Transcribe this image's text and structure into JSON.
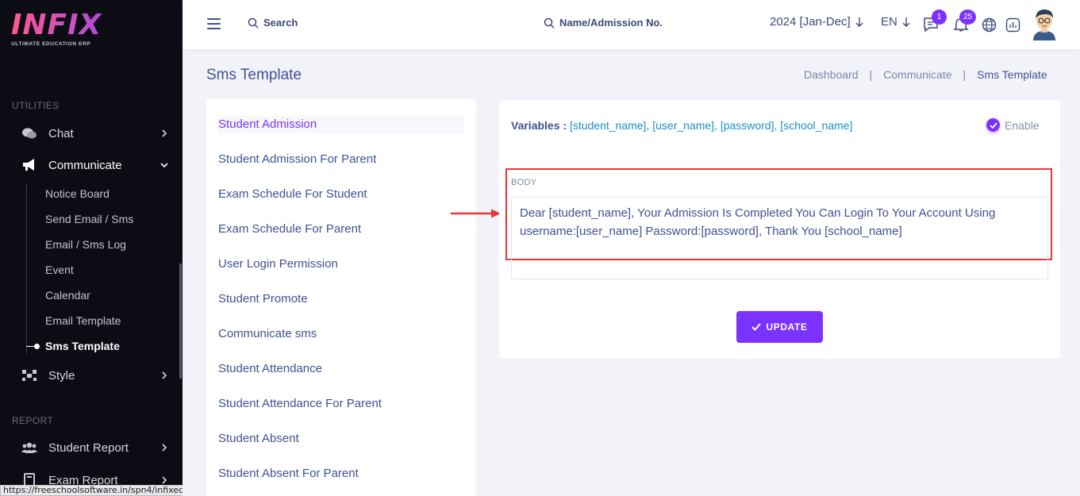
{
  "sidebar": {
    "logo": {
      "word": "INFIX",
      "subtitle": "ULTIMATE EDUCATION ERP"
    },
    "sections": {
      "utilities": "UTILITIES",
      "report": "REPORT"
    },
    "items": {
      "chat": "Chat",
      "communicate": "Communicate",
      "style": "Style",
      "student_report": "Student Report",
      "exam_report": "Exam Report"
    },
    "communicate_sub": [
      "Notice Board",
      "Send Email / Sms",
      "Email / Sms Log",
      "Event",
      "Calendar",
      "Email Template",
      "Sms Template"
    ],
    "status_url": "https://freeschoolsoftware.in/spn4/infixedu/v8.2.4/templatesettings/sms-template#student_admission"
  },
  "header": {
    "search_label": "Search",
    "admission_search_label": "Name/Admission No.",
    "session": "2024 [Jan-Dec]",
    "language": "EN",
    "message_count": "1",
    "notification_count": "25"
  },
  "page": {
    "title": "Sms Template",
    "breadcrumb": [
      "Dashboard",
      "Communicate",
      "Sms Template"
    ]
  },
  "templates": [
    "Student Admission",
    "Student Admission For Parent",
    "Exam Schedule For Student",
    "Exam Schedule For Parent",
    "User Login Permission",
    "Student Promote",
    "Communicate sms",
    "Student Attendance",
    "Student Attendance For Parent",
    "Student Absent",
    "Student Absent For Parent"
  ],
  "editor": {
    "variables_label": "Variables :",
    "variables": "[student_name], [user_name], [password], [school_name]",
    "enable_label": "Enable",
    "body_label": "BODY",
    "body_text": "Dear [student_name], Your Admission Is Completed You Can Login To Your Account Using username:[user_name] Password:[password], Thank You [school_name]",
    "update_label": "UPDATE"
  },
  "colors": {
    "accent": "#7c32ff",
    "text": "#415094",
    "sidebar_bg": "#0c0c14",
    "highlight": "#e53935"
  }
}
